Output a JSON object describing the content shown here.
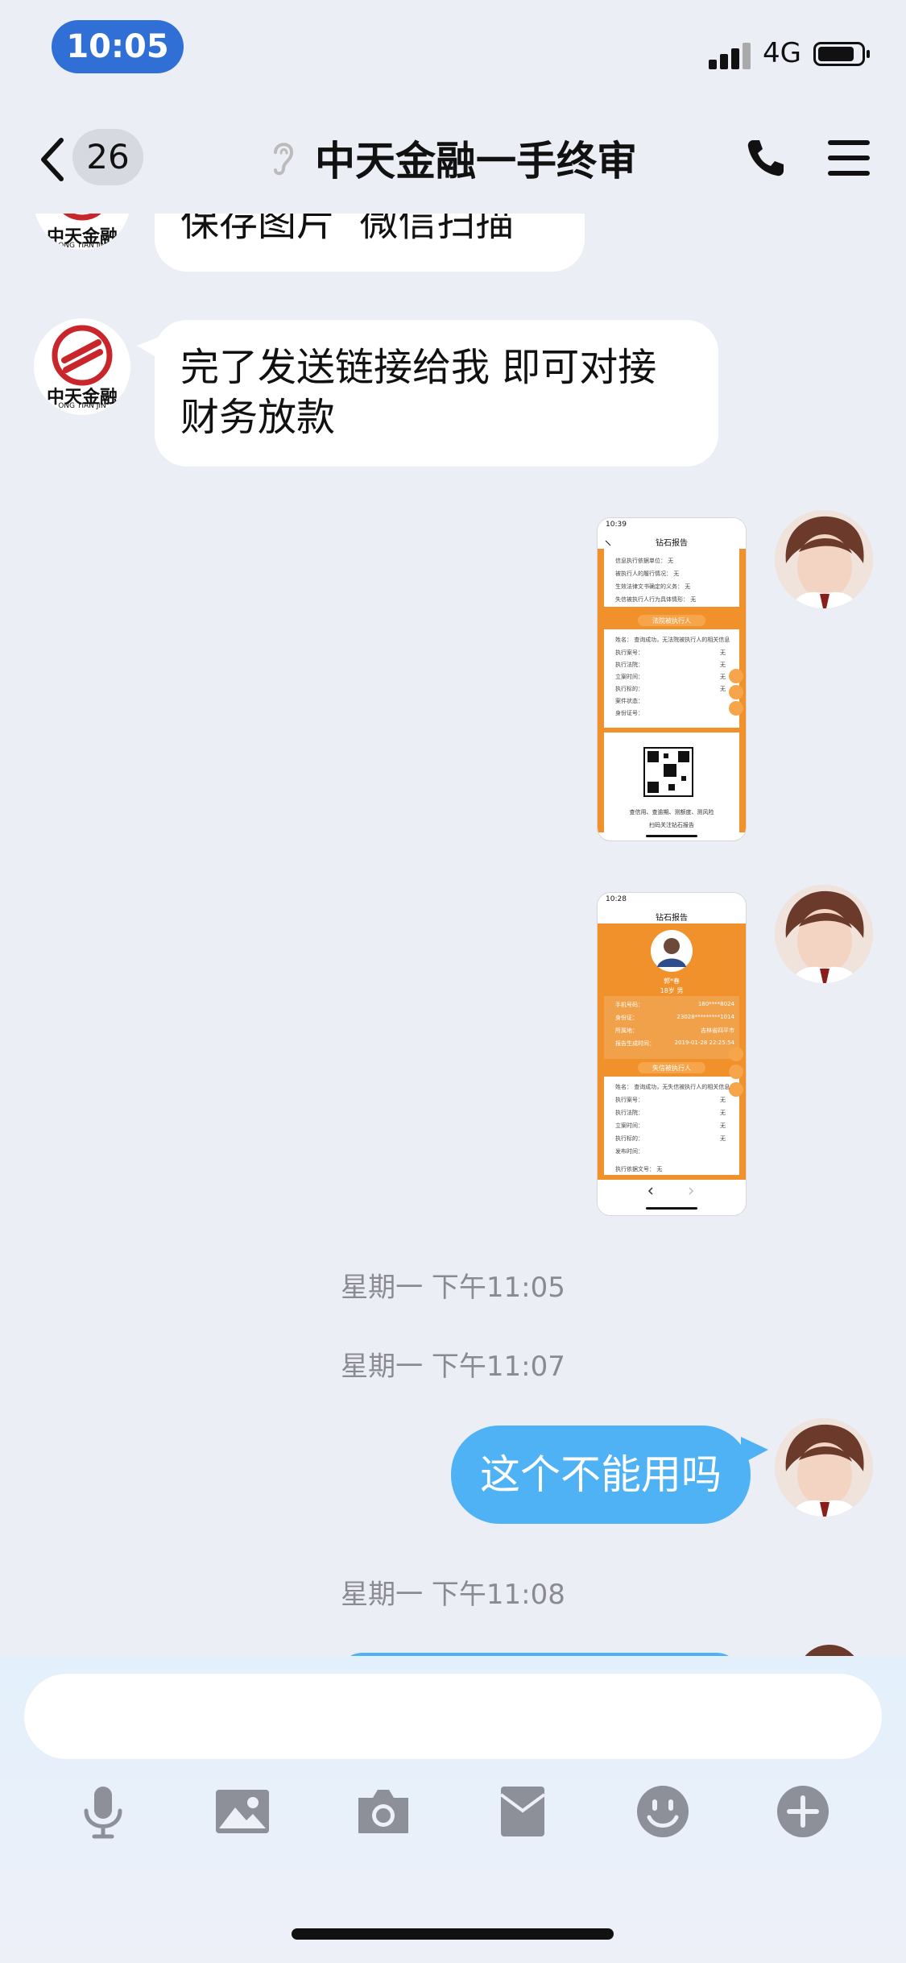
{
  "status": {
    "time": "10:05",
    "network": "4G"
  },
  "nav": {
    "unread_count": "26",
    "title": "中天金融一手终审"
  },
  "messages": {
    "m1_text": "保存图片  微信扫描",
    "m2_line1": "完了发送链接给我 即可对接",
    "m2_line2": "财务放款",
    "ts1": "星期一 下午11:05",
    "ts2": "星期一 下午11:07",
    "m5_text": "这个不能用吗",
    "ts3": "星期一 下午11:08"
  },
  "logo": {
    "cn": "中天金融",
    "en": "ONG TIAN JIN"
  },
  "shot1": {
    "time": "10:39",
    "title": "钻石报告",
    "rows": [
      "信息执行依据单位：  无",
      "被执行人的履行情况：  无",
      "生效法律文书确定的义务：  无",
      "失信被执行人行为具体情形：  无"
    ],
    "button": "法院被执行人",
    "rows2": [
      "姓名：    查询成功，无法院被执行人的相关信息",
      "执行案号：",
      "执行法院：",
      "立案时间：",
      "执行标的：",
      "案件状态：",
      "身份证号："
    ],
    "value": "无",
    "footer1": "查信用、查逾期、测额度、测风险",
    "footer2": "扫码关注钻石报告"
  },
  "shot2": {
    "time": "10:28",
    "title": "钻石报告",
    "name": "郭*春",
    "age": "18岁 男",
    "info": [
      "手机号码：",
      "身份证：",
      "所属地：",
      "报告生成时间："
    ],
    "info_vals": [
      "180****8024",
      "23028*********1014",
      "吉林省四平市",
      "2019-01-28 22:25:54"
    ],
    "button": "失信被执行人",
    "rows": [
      "姓名：    查询成功，无失信被执行人的相关信息",
      "执行案号：",
      "执行法院：",
      "立案时间：",
      "执行标的：",
      "发布时间："
    ],
    "value": "无",
    "extra": "执行依据文号：  无"
  },
  "colors": {
    "accent": "#2f6fd6",
    "bubble_out": "#4fb2f4",
    "report_orange": "#f0912c",
    "logo_red": "#c8262b"
  },
  "icons": [
    "back-chevron-icon",
    "ear-icon",
    "phone-icon",
    "menu-icon",
    "microphone-icon",
    "image-icon",
    "camera-icon",
    "red-packet-icon",
    "emoji-icon",
    "plus-icon"
  ]
}
